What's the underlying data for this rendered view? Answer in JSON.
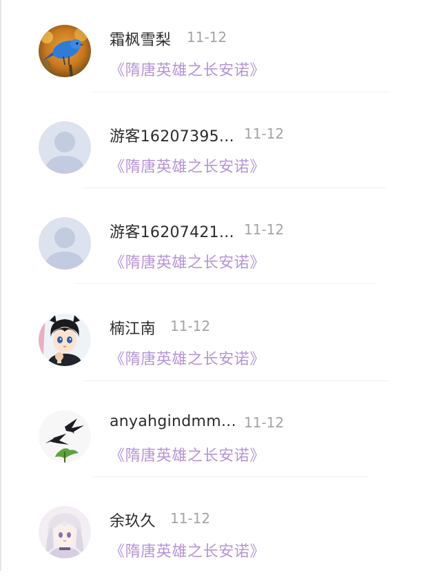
{
  "comments": [
    {
      "name": "霜枫雪梨",
      "date": "11-12",
      "link": "《隋唐英雄之长安诺》",
      "avatar": "bird-avatar-icon"
    },
    {
      "name": "游客16207395...",
      "date": "11-12",
      "link": "《隋唐英雄之长安诺》",
      "avatar": "default-user-avatar-icon"
    },
    {
      "name": "游客16207421...",
      "date": "11-12",
      "link": "《隋唐英雄之长安诺》",
      "avatar": "default-user-avatar-icon"
    },
    {
      "name": "楠江南",
      "date": "11-12",
      "link": "《隋唐英雄之长安诺》",
      "avatar": "anime-boy-avatar-icon"
    },
    {
      "name": "anyahgindmm...",
      "date": "11-12",
      "link": "《隋唐英雄之长安诺》",
      "avatar": "swallows-avatar-icon"
    },
    {
      "name": "余玖久",
      "date": "11-12",
      "link": "《隋唐英雄之长安诺》",
      "avatar": "anime-girl-avatar-icon"
    }
  ],
  "colors": {
    "link": "#b693d6",
    "name": "#2b2b2b",
    "date": "#a3a3a3",
    "default_avatar_bg": "#dde2ef",
    "default_avatar_fg": "#c3cbe0"
  }
}
